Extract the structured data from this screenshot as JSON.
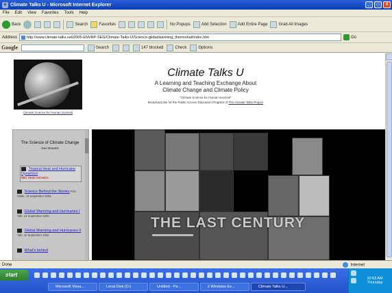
{
  "window": {
    "title": "Climate Talks U - Microsoft Internet Explorer",
    "controls": [
      "_",
      "□",
      "X"
    ]
  },
  "menu": [
    "File",
    "Edit",
    "View",
    "Favorites",
    "Tools",
    "Help"
  ],
  "toolbar": {
    "back": "Back",
    "search": "Search",
    "favorites": "Favorites",
    "signin": "No Popups",
    "addselection": "Add Selection",
    "addentirepage": "Add Entire Page",
    "grabimages": "Grab All Images"
  },
  "address": {
    "label": "Address",
    "url": "http://www.climate-talks.net/2005-ENVRP-SEG/Climate-Talks-U/Science-globalwarming_thermohal/index.htm",
    "go": "Go"
  },
  "google": {
    "logo": "Google",
    "search": "Search",
    "blocked": "147 blocked",
    "check": "Check",
    "options": "Options"
  },
  "page": {
    "globe_caption": "Climate Science for Human Survival",
    "title": "Climate Talks U",
    "subtitle1": "A Learning and Teaching Exchange About",
    "subtitle2": "Climate Change and Climate Policy",
    "quote": "\"Climate Science for Human Survival\"",
    "note": "Broadcast site for the Public Access Education Program of",
    "note_link": "The Climate Talks Project"
  },
  "sidebar": {
    "header": "The Science of Climate Change",
    "header_small": "Geo Dreams",
    "items": [
      {
        "label": "Tropical Heat and Hurricane Dynamics",
        "meta": "BBC News Animation",
        "meta_class": "meta-red"
      },
      {
        "label": "Science Behind the Stories",
        "meta": "Rob Wilde, 18 September 2005",
        "meta_class": "meta"
      },
      {
        "label": "Global Warming and Hurricanes I",
        "meta": "Talk, 14 September 2005",
        "meta_class": "meta"
      },
      {
        "label": "Global Warming and Hurricanes II",
        "meta": "Talk, 16 September 2005",
        "meta_class": "meta"
      },
      {
        "label": "What's behind",
        "meta": "",
        "meta_class": "meta"
      }
    ]
  },
  "video": {
    "overlay_text": "THE LAST CENTURY"
  },
  "status": {
    "left": "Done",
    "right": "Internet"
  },
  "taskbar": {
    "start": "start",
    "tasks": [
      "Microsoft Visua...",
      "Local Disk (D:)",
      "Untitled - Pa...",
      "2 Windows Ex...",
      "Climate Talks U..."
    ],
    "clock_time": "10:53 AM",
    "clock_day": "Thursday"
  },
  "colors": {
    "titlebar": "#0b3fb3",
    "chrome": "#ece9d8",
    "taskbar": "#2452c9",
    "start": "#2e7d2e"
  }
}
